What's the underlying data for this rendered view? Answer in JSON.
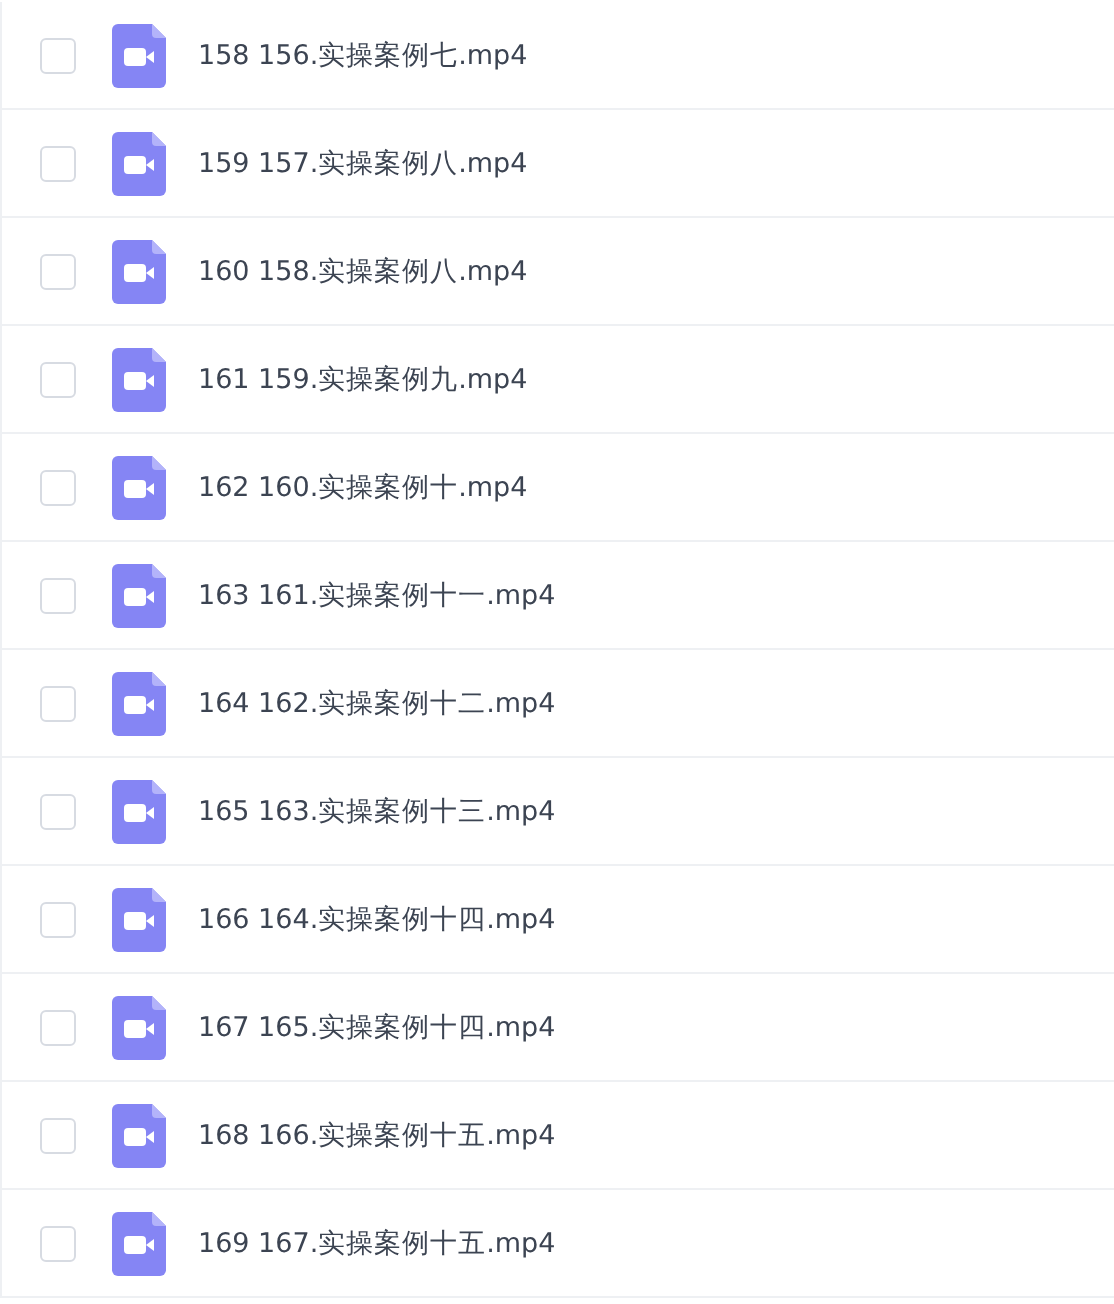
{
  "files": [
    {
      "name": "158 156.实操案例七.mp4",
      "checked": false
    },
    {
      "name": "159 157.实操案例八.mp4",
      "checked": false
    },
    {
      "name": "160 158.实操案例八.mp4",
      "checked": false
    },
    {
      "name": "161 159.实操案例九.mp4",
      "checked": false
    },
    {
      "name": "162 160.实操案例十.mp4",
      "checked": false
    },
    {
      "name": "163 161.实操案例十一.mp4",
      "checked": false
    },
    {
      "name": "164 162.实操案例十二.mp4",
      "checked": false
    },
    {
      "name": "165 163.实操案例十三.mp4",
      "checked": false
    },
    {
      "name": "166 164.实操案例十四.mp4",
      "checked": false
    },
    {
      "name": "167 165.实操案例十四.mp4",
      "checked": false
    },
    {
      "name": "168 166.实操案例十五.mp4",
      "checked": false
    },
    {
      "name": "169 167.实操案例十五.mp4",
      "checked": false
    }
  ]
}
